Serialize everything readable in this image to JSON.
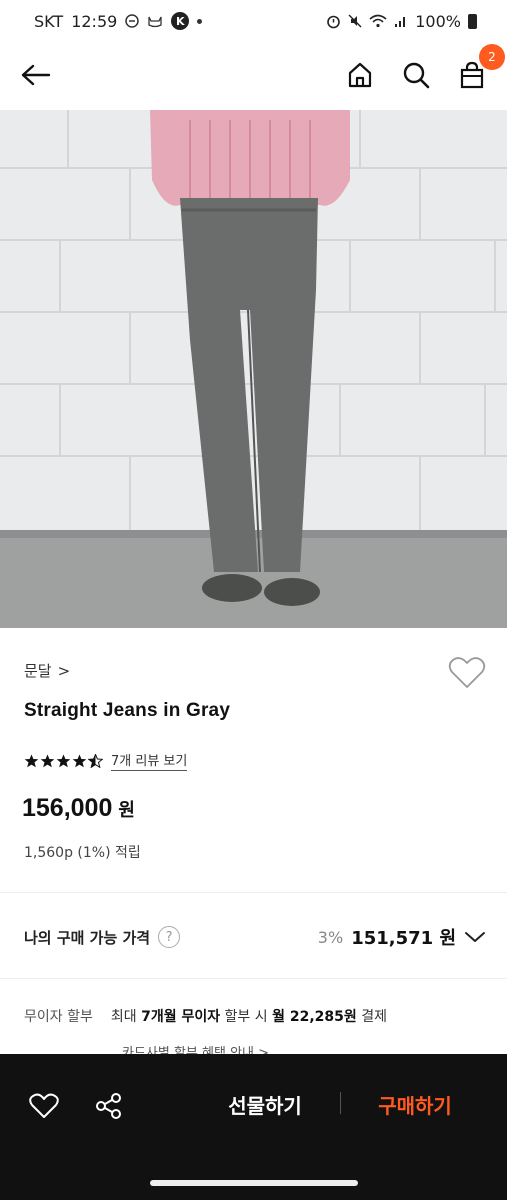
{
  "status_bar": {
    "carrier": "SKT",
    "time": "12:59",
    "battery": "100%",
    "icons": [
      "minus-circle-icon",
      "cat-icon",
      "k-app-icon",
      "notification-dot-icon",
      "alarm-icon",
      "mute-icon",
      "wifi-icon",
      "signal-icon",
      "battery-icon"
    ]
  },
  "header": {
    "back_icon": "arrow-left-icon",
    "home_icon": "home-icon",
    "search_icon": "search-icon",
    "cart_icon": "shopping-bag-icon",
    "cart_count": "2"
  },
  "product": {
    "brand": "문달",
    "brand_chevron": ">",
    "title": "Straight Jeans in Gray",
    "rating": 4.5,
    "review_link": "7개 리뷰 보기",
    "price": "156,000",
    "price_unit": "원",
    "points": "1,560p (1%) 적립"
  },
  "my_price": {
    "label": "나의 구매 가능 가격",
    "help": "?",
    "discount": "3%",
    "price": "151,571 원"
  },
  "installment": {
    "label": "무이자 할부",
    "t1": "최대 ",
    "b1": "7개월 무이자",
    "t2": " 할부 시 ",
    "b2": "월 22,285원",
    "t3": " 결제",
    "card_link": "카드사별 할부 혜택 안내 >"
  },
  "bottom_bar": {
    "wish_icon": "heart-icon",
    "share_icon": "share-icon",
    "gift": "선물하기",
    "buy": "구매하기"
  },
  "colors": {
    "accent": "#ff5a1f",
    "bar_bg": "#111111"
  }
}
